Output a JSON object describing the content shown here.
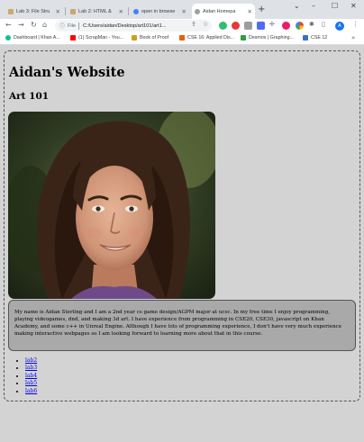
{
  "browser": {
    "tabs": [
      {
        "title": "Lab 3: File Stru",
        "icon": "canvas-icon",
        "color": "#c8a96b",
        "active": false
      },
      {
        "title": "Lab 2: HTML &",
        "icon": "canvas-icon",
        "color": "#c8a96b",
        "active": false
      },
      {
        "title": "open in browse",
        "icon": "google-icon",
        "color": "#4285f4",
        "active": false
      },
      {
        "title": "Aidan Homepa",
        "icon": "globe-icon",
        "color": "#5f6368",
        "active": true
      }
    ],
    "address": {
      "info_label": "File",
      "url": "C:/Users/aidan/Desktop/art101/art1..."
    },
    "bookmarks": [
      {
        "label": "Dashboard | Khan A...",
        "color": "#14bf96"
      },
      {
        "label": "(1) ScrapMan - You...",
        "color": "#ff0000"
      },
      {
        "label": "Book of Proof",
        "color": "#c8a21e"
      },
      {
        "label": "CSE 16: Applied Dis...",
        "color": "#e66000"
      },
      {
        "label": "Desmos | Graphing...",
        "color": "#2f9e44"
      },
      {
        "label": "CSE 12",
        "color": "#3d6fc7"
      }
    ],
    "profile_initial": "A"
  },
  "page": {
    "site_title": "Aidan's Website",
    "course_title": "Art 101",
    "bio": "My name is Aidan Sterling and I am a 2nd year cs game design/AGPM major at ucsc. In my free time I enjoy programming, playing videogames, dnd, and making 3d art. I have experience from programming in CSE20, CSE30, javascript on Khan Academy, and some c++ in Unreal Engine. Although I have lots of programming experience, I don't have very much experience making interactive webpages so I am looking forward to learning more about that in this course.",
    "labs": [
      "lab2",
      "lab3",
      "lab4",
      "lab5",
      "lab6"
    ]
  },
  "colors": {
    "page_bg": "#d3d3d3",
    "bio_bg": "#a9a9a9",
    "link": "#0000ee"
  }
}
